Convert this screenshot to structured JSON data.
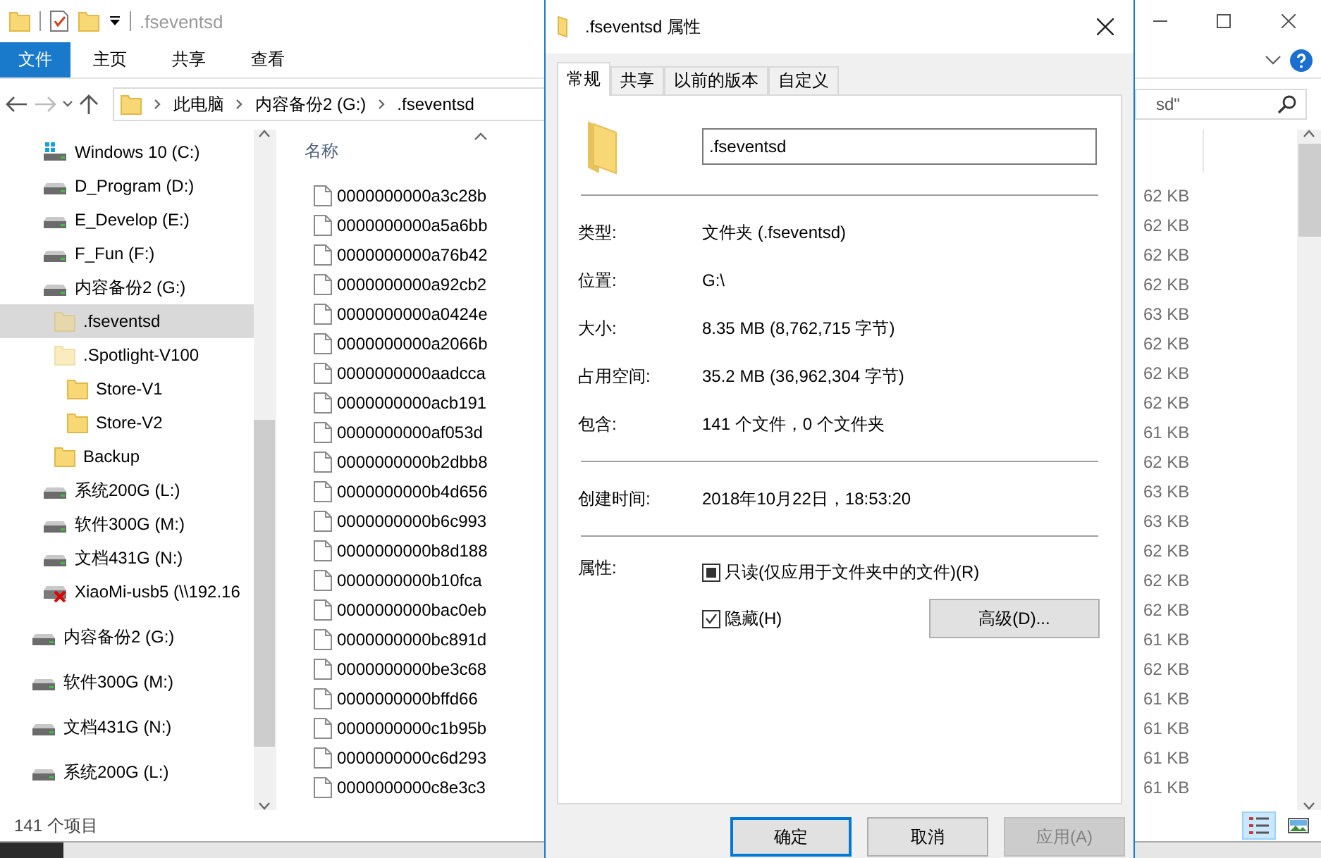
{
  "explorer": {
    "title": ".fseventsd",
    "ribbon_tabs": [
      {
        "label": "文件",
        "kind": "file-menu"
      },
      {
        "label": "主页",
        "kind": "tab"
      },
      {
        "label": "共享",
        "kind": "tab"
      },
      {
        "label": "查看",
        "kind": "tab"
      }
    ],
    "address": {
      "path": [
        "此电脑",
        "内容备份2 (G:)",
        ".fseventsd"
      ]
    },
    "search": {
      "placeholder": "sd\""
    },
    "nav_tree": [
      {
        "label": "Windows 10 (C:)",
        "kind": "system-drive",
        "selected": false
      },
      {
        "label": "D_Program (D:)",
        "kind": "drive",
        "selected": false
      },
      {
        "label": "E_Develop (E:)",
        "kind": "drive",
        "selected": false
      },
      {
        "label": "F_Fun (F:)",
        "kind": "drive",
        "selected": false
      },
      {
        "label": "内容备份2 (G:)",
        "kind": "drive",
        "selected": false,
        "children": [
          {
            "label": ".fseventsd",
            "kind": "hidden-folder",
            "selected": true
          },
          {
            "label": ".Spotlight-V100",
            "kind": "hidden-folder",
            "selected": false,
            "children": [
              {
                "label": "Store-V1",
                "kind": "folder",
                "selected": false
              },
              {
                "label": "Store-V2",
                "kind": "folder",
                "selected": false
              }
            ]
          },
          {
            "label": "Backup",
            "kind": "folder",
            "selected": false
          }
        ]
      },
      {
        "label": "系统200G (L:)",
        "kind": "drive",
        "selected": false
      },
      {
        "label": "软件300G (M:)",
        "kind": "drive",
        "selected": false
      },
      {
        "label": "文档431G (N:)",
        "kind": "drive",
        "selected": false
      },
      {
        "label": "XiaoMi-usb5 (\\\\192.16",
        "kind": "network-drive-offline",
        "selected": false
      }
    ],
    "drives": [
      {
        "label": "内容备份2 (G:)",
        "selected": false
      },
      {
        "label": "软件300G (M:)",
        "selected": false
      },
      {
        "label": "文档431G (N:)",
        "selected": false
      },
      {
        "label": "系统200G (L:)",
        "selected": false
      }
    ],
    "columns": [
      {
        "label": "名称"
      }
    ],
    "files": [
      {
        "name": "0000000000a3c28b",
        "size": "62 KB"
      },
      {
        "name": "0000000000a5a6bb",
        "size": "62 KB"
      },
      {
        "name": "0000000000a76b42",
        "size": "62 KB"
      },
      {
        "name": "0000000000a92cb2",
        "size": "62 KB"
      },
      {
        "name": "0000000000a0424e",
        "size": "63 KB"
      },
      {
        "name": "0000000000a2066b",
        "size": "62 KB"
      },
      {
        "name": "0000000000aadcca",
        "size": "62 KB"
      },
      {
        "name": "0000000000acb191",
        "size": "62 KB"
      },
      {
        "name": "0000000000af053d",
        "size": "61 KB"
      },
      {
        "name": "0000000000b2dbb8",
        "size": "62 KB"
      },
      {
        "name": "0000000000b4d656",
        "size": "63 KB"
      },
      {
        "name": "0000000000b6c993",
        "size": "63 KB"
      },
      {
        "name": "0000000000b8d188",
        "size": "62 KB"
      },
      {
        "name": "0000000000b10fca",
        "size": "62 KB"
      },
      {
        "name": "0000000000bac0eb",
        "size": "62 KB"
      },
      {
        "name": "0000000000bc891d",
        "size": "61 KB"
      },
      {
        "name": "0000000000be3c68",
        "size": "62 KB"
      },
      {
        "name": "0000000000bffd66",
        "size": "61 KB"
      },
      {
        "name": "0000000000c1b95b",
        "size": "61 KB"
      },
      {
        "name": "0000000000c6d293",
        "size": "61 KB"
      },
      {
        "name": "0000000000c8e3c3",
        "size": "61 KB"
      }
    ],
    "status_bar": {
      "count": "141 个项目",
      "views": [
        {
          "kind": "details",
          "selected": true
        },
        {
          "kind": "thumbnails",
          "selected": false
        }
      ]
    }
  },
  "dialog": {
    "title": ".fseventsd 属性",
    "tabs": [
      {
        "label": "常规",
        "selected": true
      },
      {
        "label": "共享",
        "selected": false
      },
      {
        "label": "以前的版本",
        "selected": false
      },
      {
        "label": "自定义",
        "selected": false
      }
    ],
    "name_value": ".fseventsd",
    "groups": [
      [
        {
          "label": "类型:",
          "value": "文件夹 (.fseventsd)"
        },
        {
          "label": "位置:",
          "value": "G:\\"
        },
        {
          "label": "大小:",
          "value": "8.35 MB (8,762,715 字节)"
        },
        {
          "label": "占用空间:",
          "value": "35.2 MB (36,962,304 字节)"
        },
        {
          "label": "包含:",
          "value": "141 个文件，0 个文件夹"
        }
      ],
      [
        {
          "label": "创建时间:",
          "value": "2018年10月22日，18:53:20"
        }
      ]
    ],
    "attributes": {
      "label": "属性:",
      "options": [
        {
          "label": "只读(仅应用于文件夹中的文件)(R)",
          "checked": false,
          "mixed": true
        },
        {
          "label": "隐藏(H)",
          "checked": true,
          "mixed": false
        }
      ],
      "advanced_button": "高级(D)..."
    },
    "buttons": [
      {
        "label": "确定",
        "default": true,
        "disabled": false
      },
      {
        "label": "取消",
        "default": false,
        "disabled": false
      },
      {
        "label": "应用(A)",
        "default": false,
        "disabled": true
      }
    ]
  }
}
